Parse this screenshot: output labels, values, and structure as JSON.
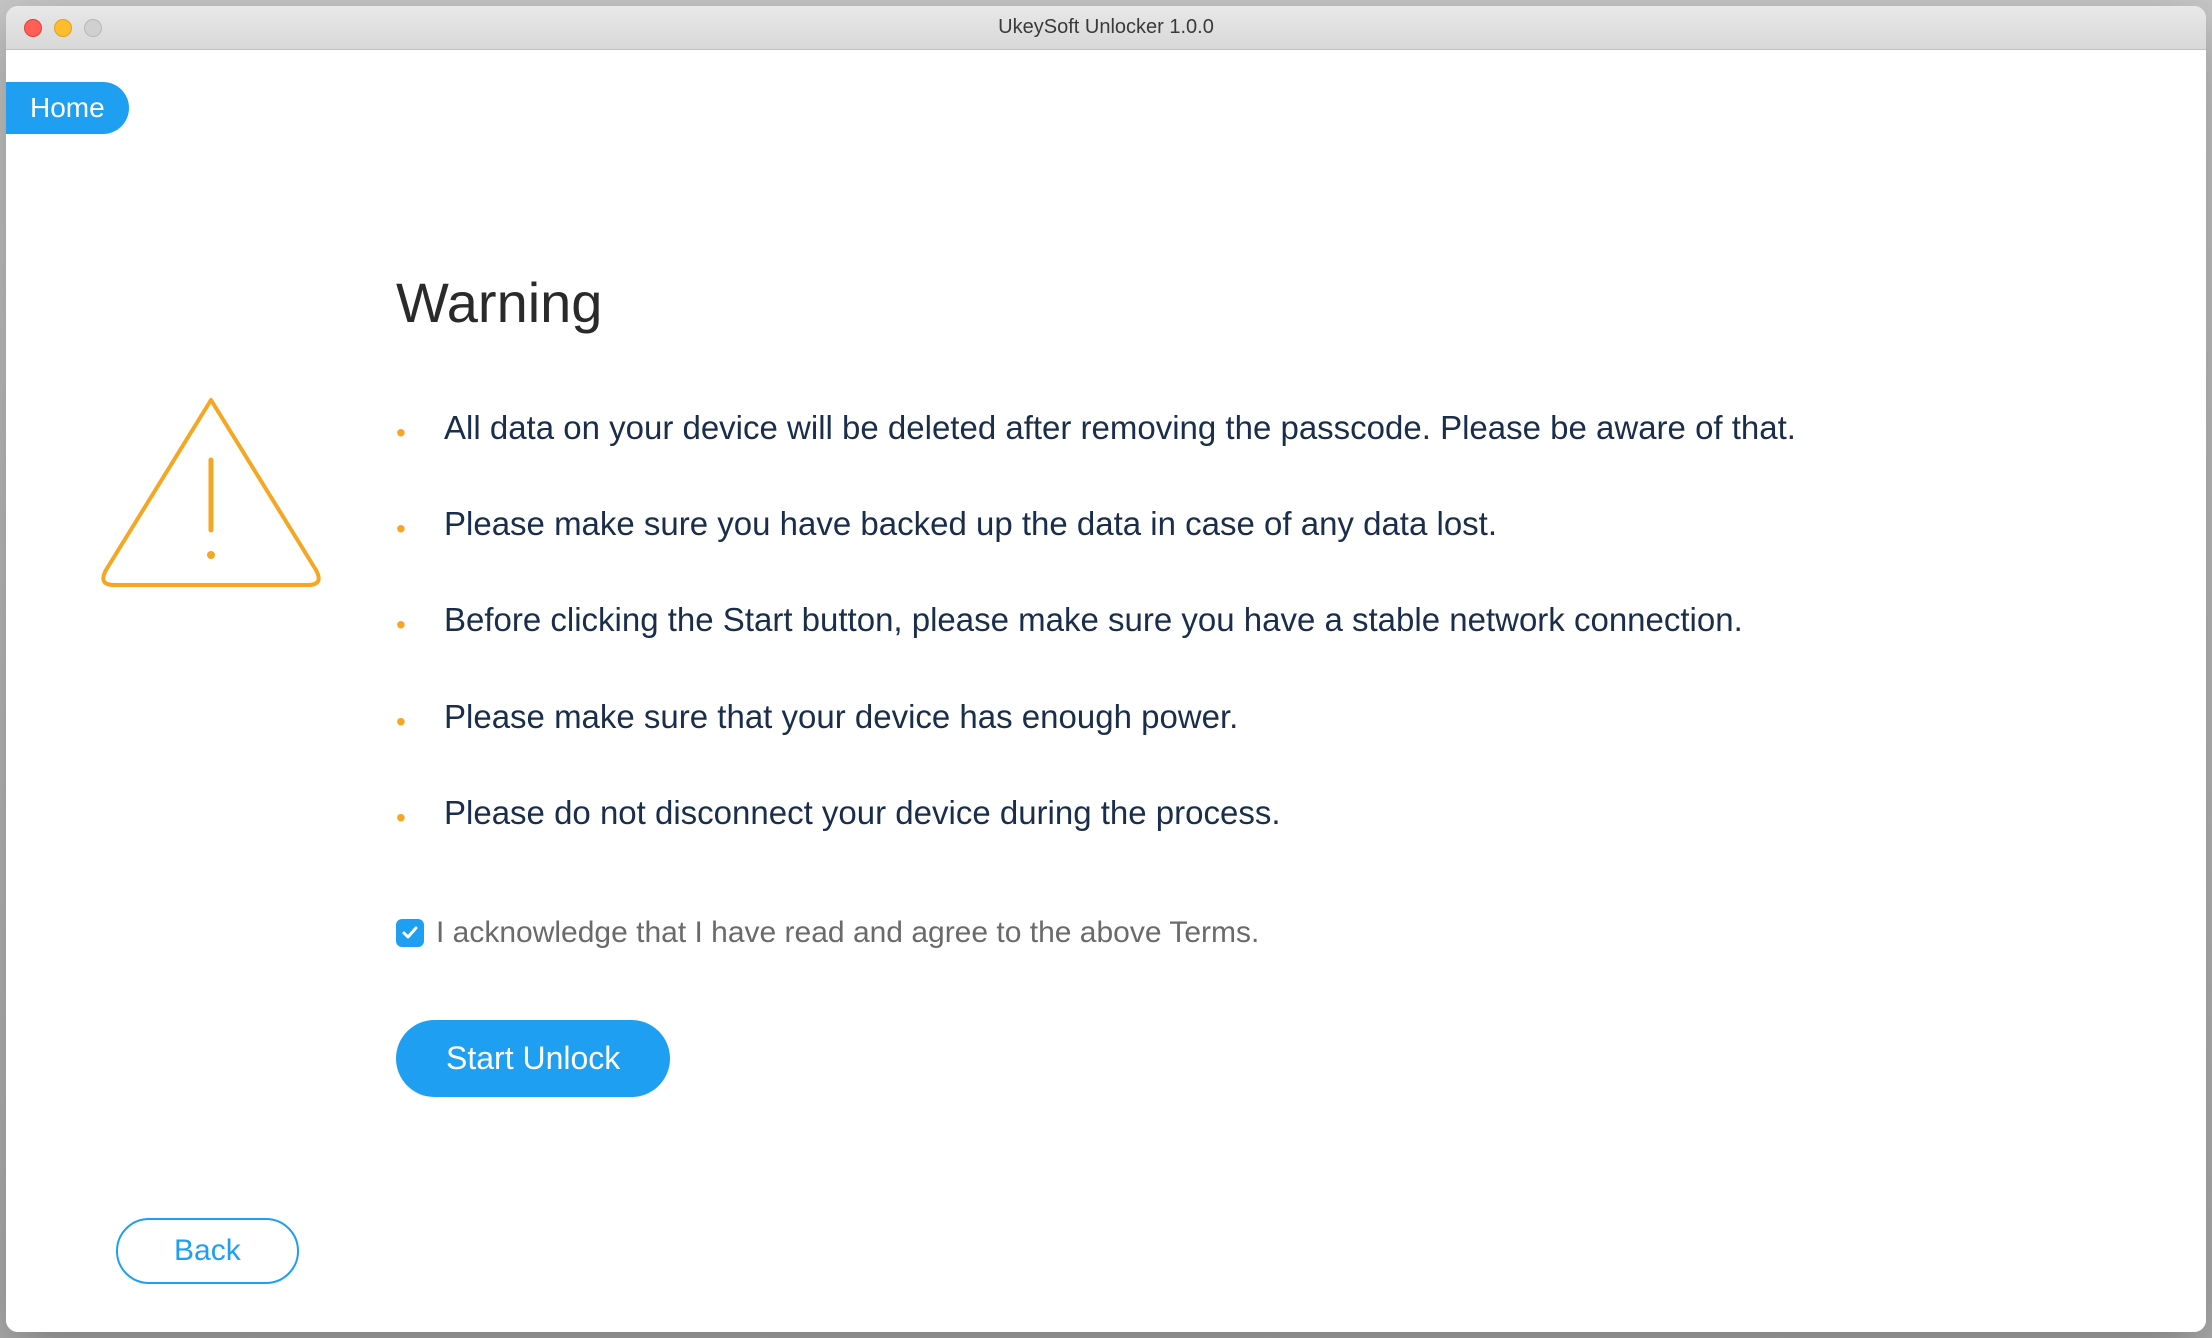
{
  "window": {
    "title": "UkeySoft Unlocker 1.0.0"
  },
  "nav": {
    "home_label": "Home"
  },
  "main": {
    "heading": "Warning",
    "bullets": [
      "All data on your device will be deleted after removing the passcode. Please be aware of that.",
      "Please make sure you have backed up the data in case of any data lost.",
      "Before clicking the Start button, please make sure you have a stable network connection.",
      "Please make sure that your device has enough power.",
      "Please do not disconnect your device during the process."
    ],
    "acknowledge_label": "I acknowledge that I have read and agree to the above Terms.",
    "acknowledge_checked": true,
    "start_label": "Start Unlock"
  },
  "footer": {
    "back_label": "Back"
  },
  "colors": {
    "accent": "#1e9ff2",
    "warning_icon": "#f5a623",
    "body_text": "#1a2d4a"
  }
}
